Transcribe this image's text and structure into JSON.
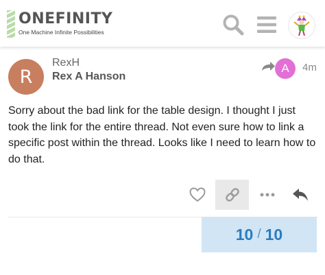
{
  "header": {
    "logo_title": "ONEFINITY",
    "logo_tagline": "One Machine Infinite Possibilities",
    "search_icon": "search-icon",
    "menu_icon": "hamburger-menu-icon",
    "user_avatar_icon": "jester-avatar-icon"
  },
  "post": {
    "avatar_letter": "R",
    "avatar_color": "#c77f5f",
    "username": "RexH",
    "full_name": "Rex A Hanson",
    "reply_to_icon": "reply-to-arrow-icon",
    "reply_to_avatar_letter": "A",
    "reply_to_avatar_color": "#e36fd6",
    "date": "4m",
    "body": "Sorry about the bad link for the table design. I thought I just took the link for the entire thread. Not even sure how to link a specific post within the thread. Looks like I need to learn how to do that."
  },
  "actions": {
    "like_icon": "heart-icon",
    "link_icon": "link-icon",
    "more_icon": "more-dots-icon",
    "reply_icon": "reply-icon"
  },
  "timeline": {
    "current": "10",
    "separator": "/",
    "total": "10",
    "progress_fraction": 1.0,
    "accent_color": "#2a7cbf",
    "fill_color": "#d1e5f5"
  }
}
